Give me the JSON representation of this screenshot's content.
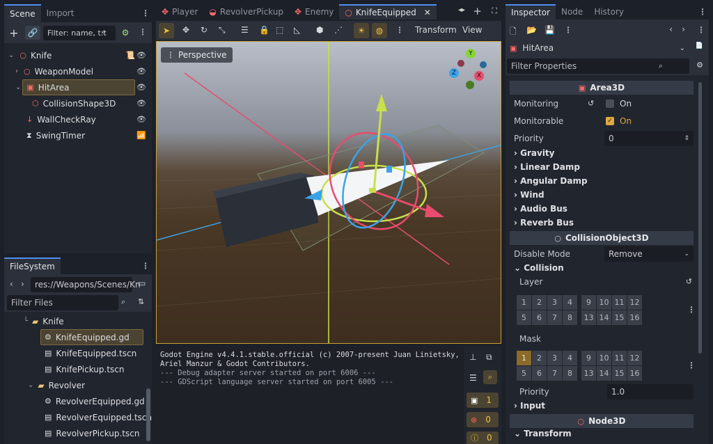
{
  "scene_dock": {
    "tabs": [
      "Scene",
      "Import"
    ],
    "filter_placeholder": "Filter: name, t:t",
    "nodes": [
      {
        "label": "Knife",
        "depth": 0
      },
      {
        "label": "WeaponModel",
        "depth": 1
      },
      {
        "label": "HitArea",
        "depth": 1
      },
      {
        "label": "CollisionShape3D",
        "depth": 2
      },
      {
        "label": "WallCheckRay",
        "depth": 1
      },
      {
        "label": "SwingTimer",
        "depth": 1
      }
    ]
  },
  "filesystem": {
    "tab": "FileSystem",
    "path": "res://Weapons/Scenes/Kn",
    "filter_placeholder": "Filter Files",
    "items": [
      {
        "label": "Knife",
        "type": "folder"
      },
      {
        "label": "KnifeEquipped.gd",
        "type": "script"
      },
      {
        "label": "KnifeEquipped.tscn",
        "type": "scene"
      },
      {
        "label": "KnifePickup.tscn",
        "type": "scene"
      },
      {
        "label": "Revolver",
        "type": "folder"
      },
      {
        "label": "RevolverEquipped.gd",
        "type": "script"
      },
      {
        "label": "RevolverEquipped.tscn",
        "type": "scene"
      },
      {
        "label": "RevolverPickup.tscn",
        "type": "scene"
      }
    ]
  },
  "editor_tabs": [
    "Player",
    "RevolverPickup",
    "Enemy",
    "KnifeEquipped"
  ],
  "toolbar": {
    "transform": "Transform",
    "view": "View"
  },
  "viewport": {
    "perspective": "Perspective",
    "gizmo_labels": {
      "y": "Y",
      "x": "X",
      "z": "Z"
    }
  },
  "console": {
    "lines": [
      "Godot Engine v4.4.1.stable.official (c) 2007-present Juan Linietsky,",
      "Ariel Manzur & Godot Contributors.",
      "--- Debug adapter server started on port 6006 ---",
      "--- GDScript language server started on port 6005 ---"
    ],
    "counts": {
      "warnings": "1",
      "errors": "0",
      "info": "0"
    }
  },
  "inspector": {
    "tabs": [
      "Inspector",
      "Node",
      "History"
    ],
    "object": "HitArea",
    "filter_placeholder": "Filter Properties",
    "area3d": "Area3D",
    "monitoring": {
      "label": "Monitoring",
      "value": "On"
    },
    "monitorable": {
      "label": "Monitorable",
      "value": "On"
    },
    "priority": {
      "label": "Priority",
      "value": "0"
    },
    "groups": [
      "Gravity",
      "Linear Damp",
      "Angular Damp",
      "Wind",
      "Audio Bus",
      "Reverb Bus"
    ],
    "collision_object": "CollisionObject3D",
    "disable_mode": {
      "label": "Disable Mode",
      "value": "Remove"
    },
    "collision": "Collision",
    "layer": "Layer",
    "mask": "Mask",
    "layer_cells_row1": [
      "1",
      "2",
      "3",
      "4",
      "9",
      "10",
      "11",
      "12"
    ],
    "layer_cells_row2": [
      "5",
      "6",
      "7",
      "8",
      "13",
      "14",
      "15",
      "16"
    ],
    "collision_priority": {
      "label": "Priority",
      "value": "1.0"
    },
    "input": "Input",
    "node3d": "Node3D",
    "transform": "Transform"
  },
  "colors": {
    "accent": "#4f8ff0",
    "warning": "#f0c040",
    "error": "#ff5d5d",
    "selected": "#4c4432"
  }
}
